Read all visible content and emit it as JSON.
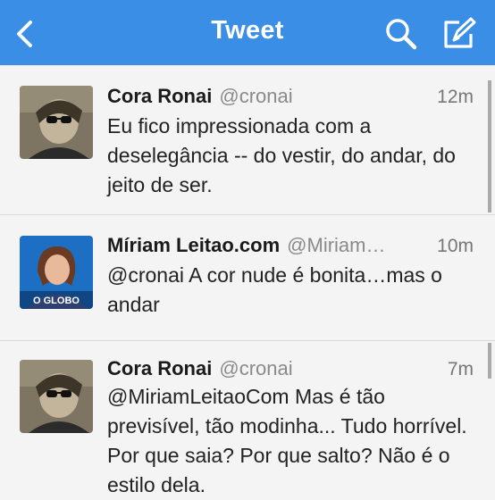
{
  "navbar": {
    "title": "Tweet",
    "back_icon": "chevron-left-icon",
    "search_icon": "search-icon",
    "compose_icon": "compose-icon",
    "background_color": "#3a8ee6"
  },
  "tweets": [
    {
      "name": "Cora Ronai",
      "handle": "@cronai",
      "time": "12m",
      "text": "Eu fico impressionada com a deselegância -- do vestir, do andar, do jeito de ser."
    },
    {
      "name": "Míriam Leitao.com",
      "handle": "@Miriam…",
      "time": "10m",
      "text": "@cronai A cor nude é bonita…mas o andar",
      "avatar_badge": "O GLOBO"
    },
    {
      "name": "Cora Ronai",
      "handle": "@cronai",
      "time": "7m",
      "text": "@MiriamLeitaoCom Mas é tão previsível, tão modinha... Tudo horrível. Por que saia? Por que salto? Não é o estilo dela."
    }
  ]
}
